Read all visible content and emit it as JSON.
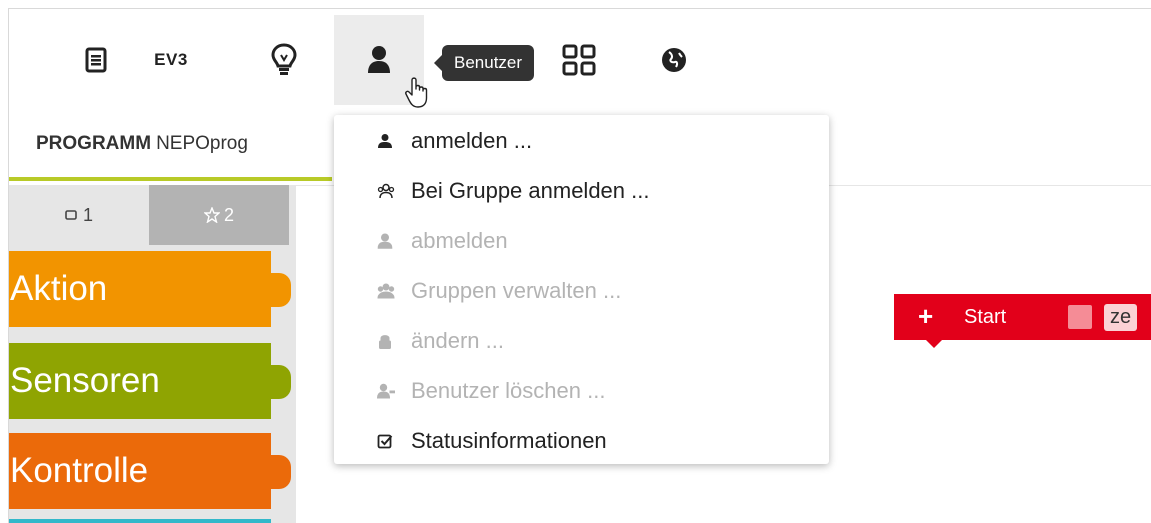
{
  "toolbar": {
    "ev3_label": "EV3",
    "tooltip": "Benutzer"
  },
  "program_tab": {
    "prefix": "PROGRAMM",
    "name": "NEPOprog"
  },
  "toolbox": {
    "tabs": [
      {
        "icon": "square-icon",
        "label": "1"
      },
      {
        "icon": "star-icon",
        "label": "2"
      }
    ],
    "categories": [
      {
        "label": "Aktion",
        "color": "#f29400"
      },
      {
        "label": "Sensoren",
        "color": "#8fa402"
      },
      {
        "label": "Kontrolle",
        "color": "#eb6a0a"
      }
    ]
  },
  "start_block": {
    "label": "Start",
    "trailing": "ze",
    "color": "#e2001a"
  },
  "user_menu": {
    "items": [
      {
        "label": "anmelden ...",
        "icon": "user-icon",
        "enabled": true
      },
      {
        "label": "Bei Gruppe anmelden ...",
        "icon": "group-icon",
        "enabled": true
      },
      {
        "label": "abmelden",
        "icon": "user-outline-icon",
        "enabled": false
      },
      {
        "label": "Gruppen verwalten ...",
        "icon": "groups-icon",
        "enabled": false
      },
      {
        "label": "ändern ...",
        "icon": "lock-icon",
        "enabled": false
      },
      {
        "label": "Benutzer löschen ...",
        "icon": "user-minus-icon",
        "enabled": false
      },
      {
        "label": "Statusinformationen",
        "icon": "checkbox-icon",
        "enabled": true
      }
    ]
  }
}
